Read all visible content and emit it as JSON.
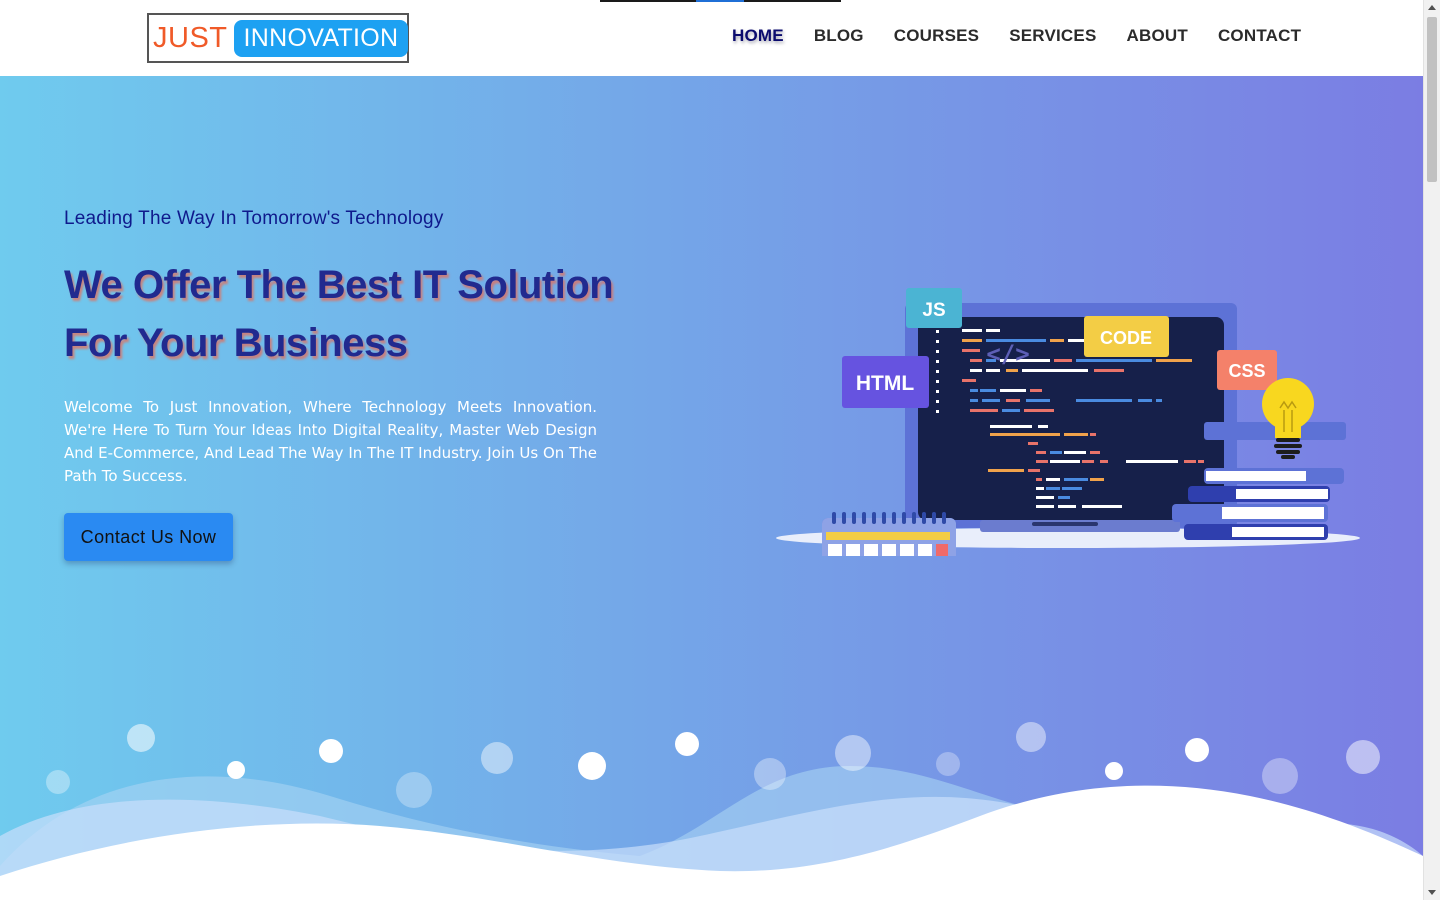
{
  "brand": {
    "logo_part1": "JUST",
    "logo_part2": "INNOVATION",
    "accent_orange": "#f05a28",
    "accent_blue": "#1da1f2"
  },
  "nav": {
    "items": [
      {
        "label": "HOME",
        "active": true
      },
      {
        "label": "BLOG",
        "active": false
      },
      {
        "label": "COURSES",
        "active": false
      },
      {
        "label": "SERVICES",
        "active": false
      },
      {
        "label": "ABOUT",
        "active": false
      },
      {
        "label": "CONTACT",
        "active": false
      }
    ]
  },
  "hero": {
    "tagline": "Leading The Way In Tomorrow's Technology",
    "headline_line1": "We Offer The Best IT Solution",
    "headline_line2": "For Your Business",
    "intro": "Welcome To Just Innovation, Where Technology Meets Innovation. We're Here To Turn Your Ideas Into Digital Reality, Master Web Design And E-Commerce, And Lead The Way In The IT Industry. Join Us On The Path To Success.",
    "cta_label": "Contact Us Now",
    "gradient_start": "#6fcbee",
    "gradient_end": "#7b7de3"
  },
  "illustration": {
    "tags": {
      "js": "JS",
      "code": "CODE",
      "html": "HTML",
      "css": "CSS",
      "code_symbol": "</>"
    }
  }
}
